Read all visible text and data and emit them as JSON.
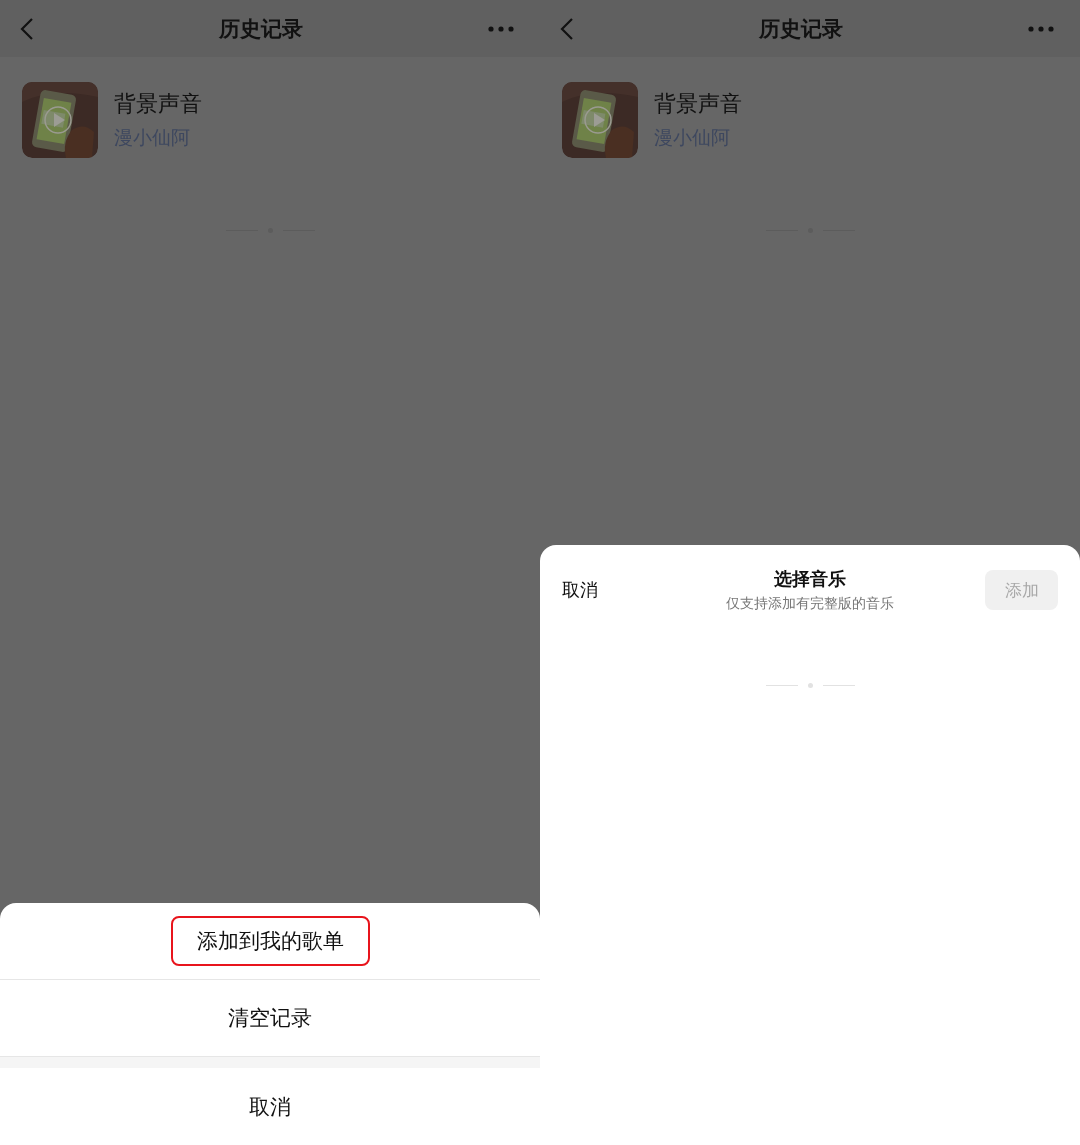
{
  "screens": [
    {
      "header": {
        "title": "历史记录"
      },
      "history": [
        {
          "title": "背景声音",
          "artist": "漫小仙阿"
        }
      ],
      "sheet": {
        "kind": "action_sheet",
        "actions": [
          {
            "label": "添加到我的歌单",
            "highlighted": true
          },
          {
            "label": "清空记录",
            "highlighted": false
          }
        ],
        "cancel": "取消"
      }
    },
    {
      "header": {
        "title": "历史记录"
      },
      "history": [
        {
          "title": "背景声音",
          "artist": "漫小仙阿"
        }
      ],
      "sheet": {
        "kind": "music_picker",
        "cancel": "取消",
        "title": "选择音乐",
        "subtitle": "仅支持添加有完整版的音乐",
        "add_button": {
          "label": "添加",
          "disabled": true
        }
      }
    }
  ]
}
